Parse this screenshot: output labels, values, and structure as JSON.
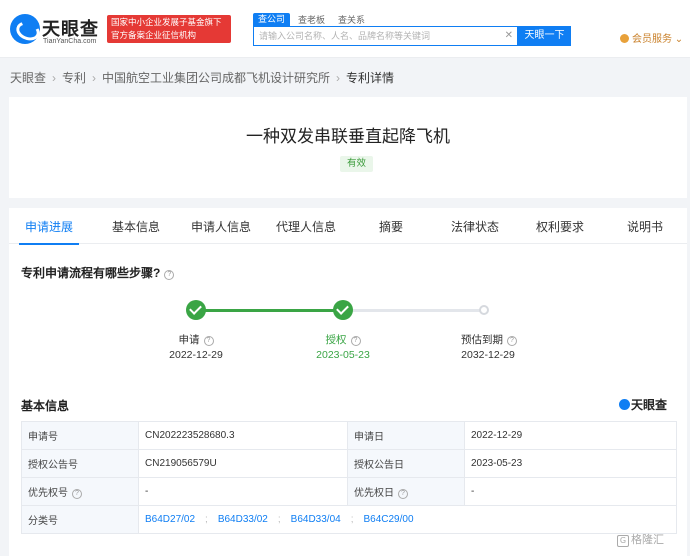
{
  "header": {
    "logo_cn": "天眼查",
    "logo_en": "TianYanCha.com",
    "gov_badge_line1": "国家中小企业发展子基金旗下",
    "gov_badge_line2": "官方备案企业征信机构",
    "search_tabs": [
      "查公司",
      "查老板",
      "查关系"
    ],
    "search_placeholder": "请输入公司名称、人名、品牌名称等关键词",
    "search_button": "天眼一下",
    "vip_label": "会员服务"
  },
  "breadcrumb": [
    "天眼查",
    "专利",
    "中国航空工业集团公司成都飞机设计研究所",
    "专利详情"
  ],
  "patent": {
    "title": "一种双发串联垂直起降飞机",
    "status": "有效"
  },
  "tabs": [
    "申请进展",
    "基本信息",
    "申请人信息",
    "代理人信息",
    "摘要",
    "法律状态",
    "权利要求",
    "说明书"
  ],
  "progress": {
    "question": "专利申请流程有哪些步骤?",
    "steps": [
      {
        "label": "申请",
        "date": "2022-12-29"
      },
      {
        "label": "授权",
        "date": "2023-05-23"
      },
      {
        "label": "预估到期",
        "date": "2032-12-29"
      }
    ]
  },
  "basic_info": {
    "title": "基本信息",
    "brand": "天眼查",
    "rows": [
      {
        "k1": "申请号",
        "v1": "CN202223528680.3",
        "k2": "申请日",
        "v2": "2022-12-29"
      },
      {
        "k1": "授权公告号",
        "v1": "CN219056579U",
        "k2": "授权公告日",
        "v2": "2023-05-23"
      },
      {
        "k1": "优先权号",
        "v1": "-",
        "k2": "优先权日",
        "v2": "-"
      }
    ],
    "class_label": "分类号",
    "class_codes": [
      "B64D27/02",
      "B64D33/02",
      "B64D33/04",
      "B64C29/00"
    ]
  },
  "watermark": "格隆汇"
}
